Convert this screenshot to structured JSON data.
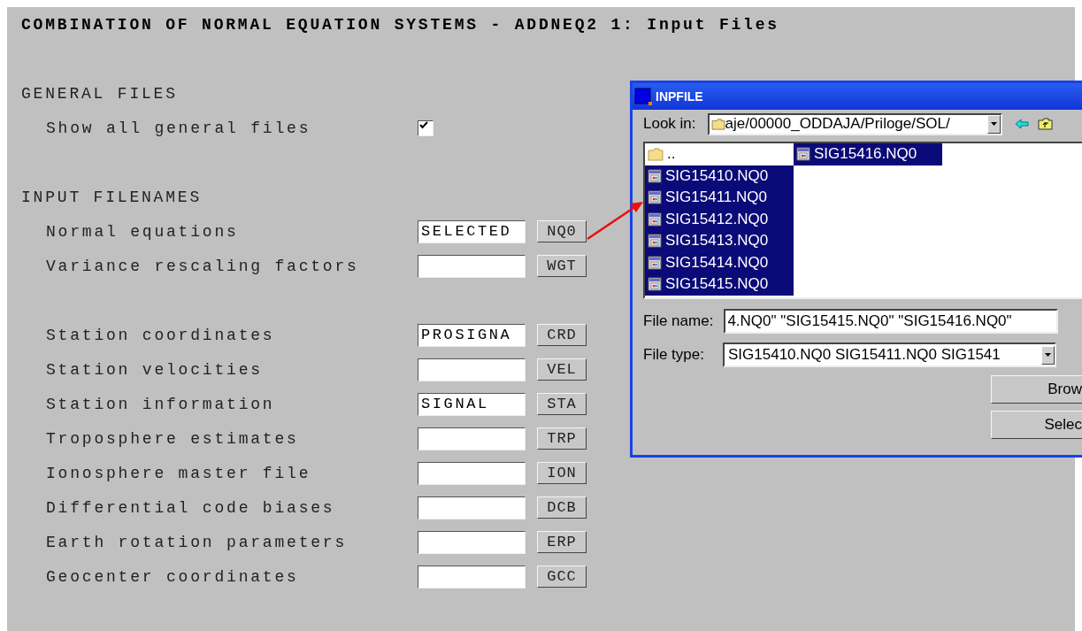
{
  "title": "COMBINATION OF NORMAL EQUATION SYSTEMS - ADDNEQ2 1: Input Files",
  "sections": [
    {
      "heading": "GENERAL FILES",
      "groups": [
        [
          {
            "kind": "checkbox",
            "label": "Show all general files",
            "checked": true
          }
        ]
      ]
    },
    {
      "heading": "INPUT FILENAMES",
      "groups": [
        [
          {
            "kind": "file",
            "label": "Normal equations",
            "value": "SELECTED",
            "button": "NQ0"
          },
          {
            "kind": "file",
            "label": "Variance rescaling factors",
            "button": "WGT"
          }
        ],
        [
          {
            "kind": "file",
            "label": "Station coordinates",
            "value": "PROSIGNA",
            "button": "CRD"
          },
          {
            "kind": "file",
            "label": "Station velocities",
            "button": "VEL"
          },
          {
            "kind": "file",
            "label": "Station information",
            "value": "SIGNAL",
            "button": "STA"
          },
          {
            "kind": "file",
            "label": "Troposphere estimates",
            "button": "TRP"
          },
          {
            "kind": "file",
            "label": "Ionosphere master file",
            "button": "ION"
          },
          {
            "kind": "file",
            "label": "Differential code biases",
            "button": "DCB"
          },
          {
            "kind": "file",
            "label": "Earth rotation parameters",
            "button": "ERP"
          },
          {
            "kind": "file",
            "label": "Geocenter coordinates",
            "button": "GCC"
          }
        ]
      ]
    }
  ],
  "dialog": {
    "title": "INPFILE",
    "look_in": {
      "label": "Look in:",
      "value": "aje/00000_ODDAJA/Priloge/SOL/"
    },
    "files": [
      {
        "kind": "folder",
        "name": "..",
        "selected": false
      },
      {
        "kind": "file",
        "name": "SIG15410.NQ0",
        "selected": true
      },
      {
        "kind": "file",
        "name": "SIG15411.NQ0",
        "selected": true
      },
      {
        "kind": "file",
        "name": "SIG15412.NQ0",
        "selected": true
      },
      {
        "kind": "file",
        "name": "SIG15413.NQ0",
        "selected": true
      },
      {
        "kind": "file",
        "name": "SIG15414.NQ0",
        "selected": true
      },
      {
        "kind": "file",
        "name": "SIG15415.NQ0",
        "selected": true
      },
      {
        "kind": "file",
        "name": "SIG15416.NQ0",
        "selected": true
      }
    ],
    "file_name": {
      "label": "File name:",
      "value": "4.NQ0\" \"SIG15415.NQ0\" \"SIG15416.NQ0\""
    },
    "file_type": {
      "label": "File type:",
      "value": "SIG15410.NQ0 SIG15411.NQ0 SIG1541"
    },
    "buttons": [
      "Brow",
      "Selec"
    ]
  }
}
